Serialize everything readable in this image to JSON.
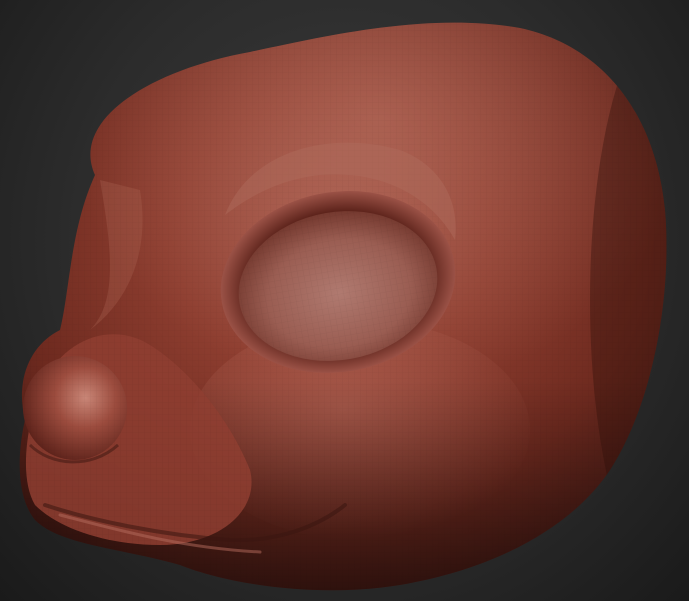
{
  "scene": {
    "subject": "sculpted-animal-head",
    "background_color": "#2c2c2c",
    "material_color": "#8a3a2c",
    "highlight_color": "#c07a6a",
    "shadow_color": "#3a1510"
  }
}
